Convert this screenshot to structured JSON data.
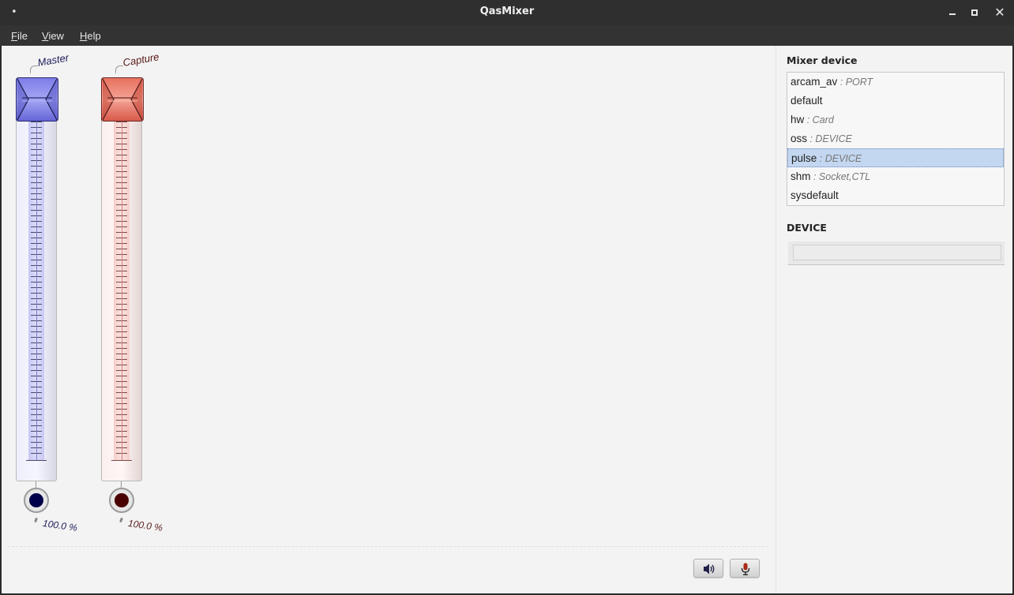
{
  "window": {
    "title": "QasMixer",
    "menu_dot": "•",
    "close_glyph": "✕"
  },
  "menu": {
    "file": {
      "accel": "F",
      "rest": "ile"
    },
    "view": {
      "accel": "V",
      "rest": "iew"
    },
    "help": {
      "accel": "H",
      "rest": "elp"
    }
  },
  "sliders": [
    {
      "label": "Master",
      "value_text": "100.0 %",
      "level": 1.0,
      "color": "#00004a",
      "accent": "#6b6be0"
    },
    {
      "label": "Capture",
      "value_text": "100.0 %",
      "level": 1.0,
      "color": "#4a0000",
      "accent": "#e07060"
    }
  ],
  "toolbar": {
    "playback_icon": "speaker-icon",
    "capture_icon": "microphone-icon"
  },
  "mixer_device": {
    "title": "Mixer device",
    "items": [
      {
        "name": "arcam_av",
        "type": " : PORT"
      },
      {
        "name": "default",
        "type": ""
      },
      {
        "name": "hw",
        "type": " : Card"
      },
      {
        "name": "oss",
        "type": " : DEVICE"
      },
      {
        "name": "pulse",
        "type": " : DEVICE",
        "selected": true
      },
      {
        "name": "shm",
        "type": " : Socket,CTL"
      },
      {
        "name": "sysdefault",
        "type": ""
      }
    ],
    "selected_color": "#c3d7f0"
  },
  "device_section": {
    "title": "DEVICE",
    "value": ""
  }
}
